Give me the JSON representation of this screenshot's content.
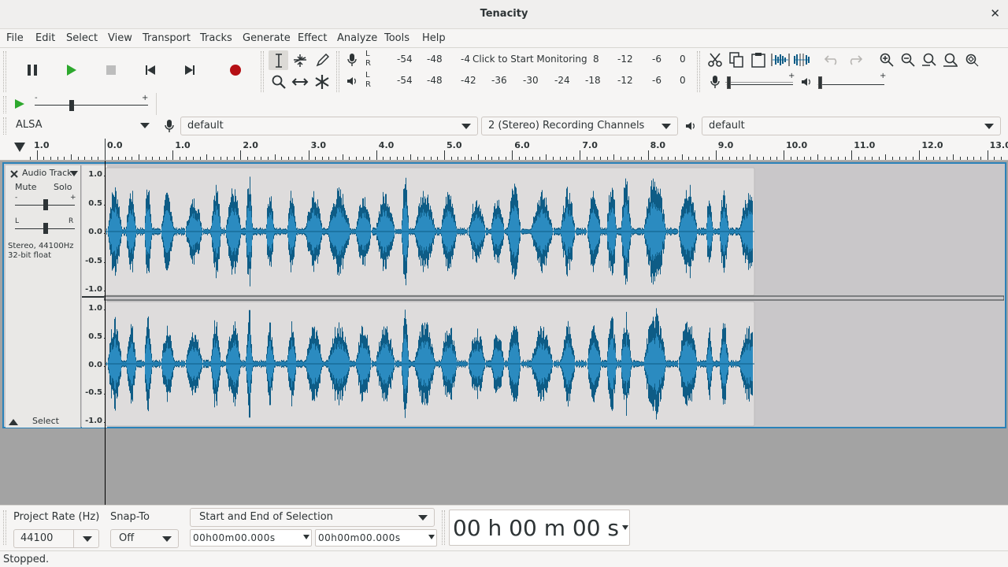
{
  "window": {
    "title": "Tenacity",
    "close_glyph": "✕"
  },
  "menubar": {
    "items": [
      "File",
      "Edit",
      "Select",
      "View",
      "Transport",
      "Tracks",
      "Generate",
      "Effect",
      "Analyze",
      "Tools",
      "Help"
    ]
  },
  "meters": {
    "record_scale": [
      "-54",
      "-48",
      "-4",
      "8",
      "-12",
      "-6",
      "0"
    ],
    "record_prompt": "Click to Start Monitoring",
    "playback_scale": [
      "-54",
      "-48",
      "-42",
      "-36",
      "-30",
      "-24",
      "-18",
      "-12",
      "-6",
      "0"
    ],
    "lr": [
      "L",
      "R"
    ]
  },
  "mixer": {
    "minus": "-",
    "plus": "+"
  },
  "play_at_speed": {
    "minus": "-",
    "plus": "+"
  },
  "device": {
    "host": "ALSA",
    "recording_device": "default",
    "channels": "2 (Stereo) Recording Channels",
    "playback_device": "default"
  },
  "ruler": {
    "labels": [
      "1.0",
      "0.0",
      "1.0",
      "2.0",
      "3.0",
      "4.0",
      "5.0",
      "6.0",
      "7.0",
      "8.0",
      "9.0",
      "10.0",
      "11.0",
      "12.0",
      "13.0"
    ]
  },
  "track": {
    "name": "Audio Track",
    "mute": "Mute",
    "solo": "Solo",
    "gain_minus": "-",
    "gain_plus": "+",
    "pan_left": "L",
    "pan_right": "R",
    "info_line1": "Stereo, 44100Hz",
    "info_line2": "32-bit float",
    "select": "Select",
    "vruler_labels": [
      "1.0",
      "0.5",
      "0.0",
      "-0.5",
      "-1.0"
    ]
  },
  "selection": {
    "project_rate_label": "Project Rate (Hz)",
    "project_rate_value": "44100",
    "snap_to_label": "Snap-To",
    "snap_to_value": "Off",
    "selection_mode": "Start and End of Selection",
    "start_time": "00h00m00.000s",
    "end_time": "00h00m00.000s",
    "audio_position": "00 h 00 m 00 s"
  },
  "status": {
    "text": "Stopped."
  },
  "colors": {
    "waveform": "#0e5c86",
    "waveform_rms": "#2b8bc0",
    "track_focus": "#2a82b9",
    "record_red": "#b50f14",
    "play_green": "#2da82d"
  }
}
